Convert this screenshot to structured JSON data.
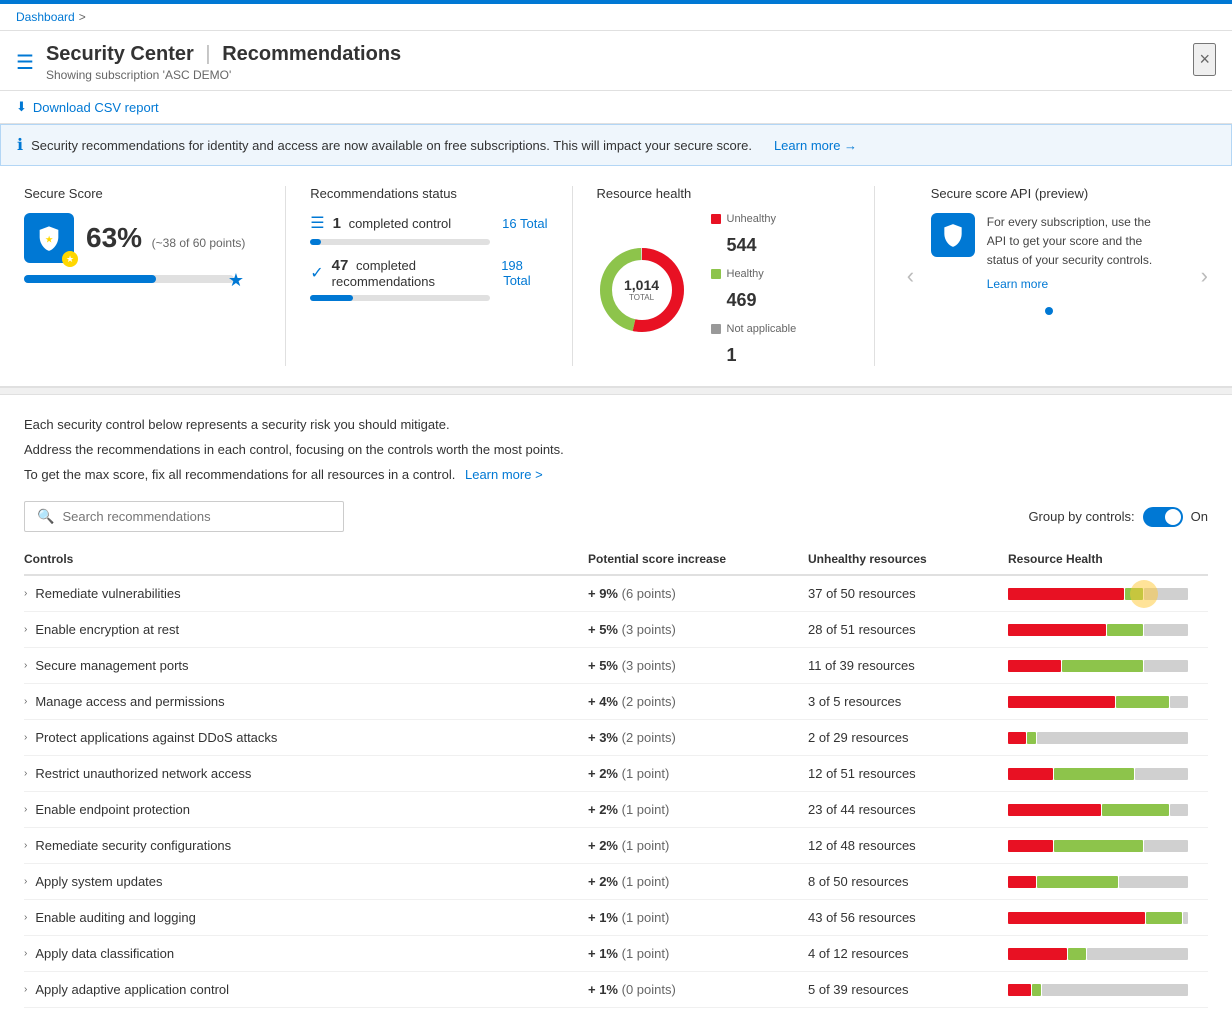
{
  "topbar": {
    "color": "#0078d4"
  },
  "breadcrumb": {
    "items": [
      "Dashboard"
    ],
    "sep": ">"
  },
  "header": {
    "icon": "☰",
    "title": "Security Center",
    "separator": "|",
    "subtitle_part": "Recommendations",
    "subscription": "Showing subscription 'ASC DEMO'",
    "close_label": "×"
  },
  "toolbar": {
    "download_label": "Download CSV report",
    "download_icon": "⬇"
  },
  "info_banner": {
    "text": "Security recommendations for identity and access are now available on free subscriptions. This will impact your secure score.",
    "link_text": "Learn more →"
  },
  "metrics": {
    "secure_score": {
      "label": "Secure Score",
      "percent": "63%",
      "detail": "(~38 of 60 points)",
      "bar_percent": 63
    },
    "recommendations_status": {
      "label": "Recommendations status",
      "completed_controls": 1,
      "controls_total": 16,
      "controls_label": "completed control",
      "controls_total_label": "Total",
      "completed_recs": 47,
      "recs_total": 198,
      "recs_label": "completed recommendations",
      "recs_total_label": "Total",
      "controls_bar_percent": 6,
      "recs_bar_percent": 24
    },
    "resource_health": {
      "label": "Resource health",
      "total": "1,014",
      "total_label": "TOTAL",
      "unhealthy_count": "544",
      "unhealthy_label": "Unhealthy",
      "unhealthy_color": "#e81123",
      "healthy_count": "469",
      "healthy_label": "Healthy",
      "healthy_color": "#8dc44b",
      "na_count": "1",
      "na_label": "Not applicable",
      "na_color": "#999",
      "donut_unhealthy_pct": 53.6,
      "donut_healthy_pct": 46.2
    },
    "api_preview": {
      "label": "Secure score API (preview)",
      "icon": "🛡",
      "description": "For every subscription, use the API to get your score and the status of your security controls.",
      "learn_more": "Learn more"
    }
  },
  "description": {
    "line1": "Each security control below represents a security risk you should mitigate.",
    "line2": "Address the recommendations in each control, focusing on the controls worth the most points.",
    "line3": "To get the max score, fix all recommendations for all resources in a control.",
    "learn_more_link": "Learn more >"
  },
  "search": {
    "placeholder": "Search recommendations"
  },
  "group_by": {
    "label": "Group by controls:",
    "state": "On"
  },
  "table": {
    "columns": [
      "Controls",
      "Potential score increase",
      "Unhealthy resources",
      "Resource Health"
    ],
    "rows": [
      {
        "name": "Remediate vulnerabilities",
        "score_pct": "+ 9%",
        "score_pts": "(6 points)",
        "resources": "37 of 50 resources",
        "red_pct": 65,
        "green_pct": 10,
        "gray_pct": 25
      },
      {
        "name": "Enable encryption at rest",
        "score_pct": "+ 5%",
        "score_pts": "(3 points)",
        "resources": "28 of 51 resources",
        "red_pct": 55,
        "green_pct": 20,
        "gray_pct": 25
      },
      {
        "name": "Secure management ports",
        "score_pct": "+ 5%",
        "score_pts": "(3 points)",
        "resources": "11 of 39 resources",
        "red_pct": 30,
        "green_pct": 45,
        "gray_pct": 25
      },
      {
        "name": "Manage access and permissions",
        "score_pct": "+ 4%",
        "score_pts": "(2 points)",
        "resources": "3 of 5 resources",
        "red_pct": 60,
        "green_pct": 30,
        "gray_pct": 10
      },
      {
        "name": "Protect applications against DDoS attacks",
        "score_pct": "+ 3%",
        "score_pts": "(2 points)",
        "resources": "2 of 29 resources",
        "red_pct": 10,
        "green_pct": 5,
        "gray_pct": 85
      },
      {
        "name": "Restrict unauthorized network access",
        "score_pct": "+ 2%",
        "score_pts": "(1 point)",
        "resources": "12 of 51 resources",
        "red_pct": 25,
        "green_pct": 45,
        "gray_pct": 30
      },
      {
        "name": "Enable endpoint protection",
        "score_pct": "+ 2%",
        "score_pts": "(1 point)",
        "resources": "23 of 44 resources",
        "red_pct": 52,
        "green_pct": 38,
        "gray_pct": 10
      },
      {
        "name": "Remediate security configurations",
        "score_pct": "+ 2%",
        "score_pts": "(1 point)",
        "resources": "12 of 48 resources",
        "red_pct": 25,
        "green_pct": 50,
        "gray_pct": 25
      },
      {
        "name": "Apply system updates",
        "score_pct": "+ 2%",
        "score_pts": "(1 point)",
        "resources": "8 of 50 resources",
        "red_pct": 16,
        "green_pct": 45,
        "gray_pct": 39
      },
      {
        "name": "Enable auditing and logging",
        "score_pct": "+ 1%",
        "score_pts": "(1 point)",
        "resources": "43 of 56 resources",
        "red_pct": 77,
        "green_pct": 20,
        "gray_pct": 3
      },
      {
        "name": "Apply data classification",
        "score_pct": "+ 1%",
        "score_pts": "(1 point)",
        "resources": "4 of 12 resources",
        "red_pct": 33,
        "green_pct": 10,
        "gray_pct": 57
      },
      {
        "name": "Apply adaptive application control",
        "score_pct": "+ 1%",
        "score_pts": "(0 points)",
        "resources": "5 of 39 resources",
        "red_pct": 13,
        "green_pct": 5,
        "gray_pct": 82
      }
    ]
  }
}
